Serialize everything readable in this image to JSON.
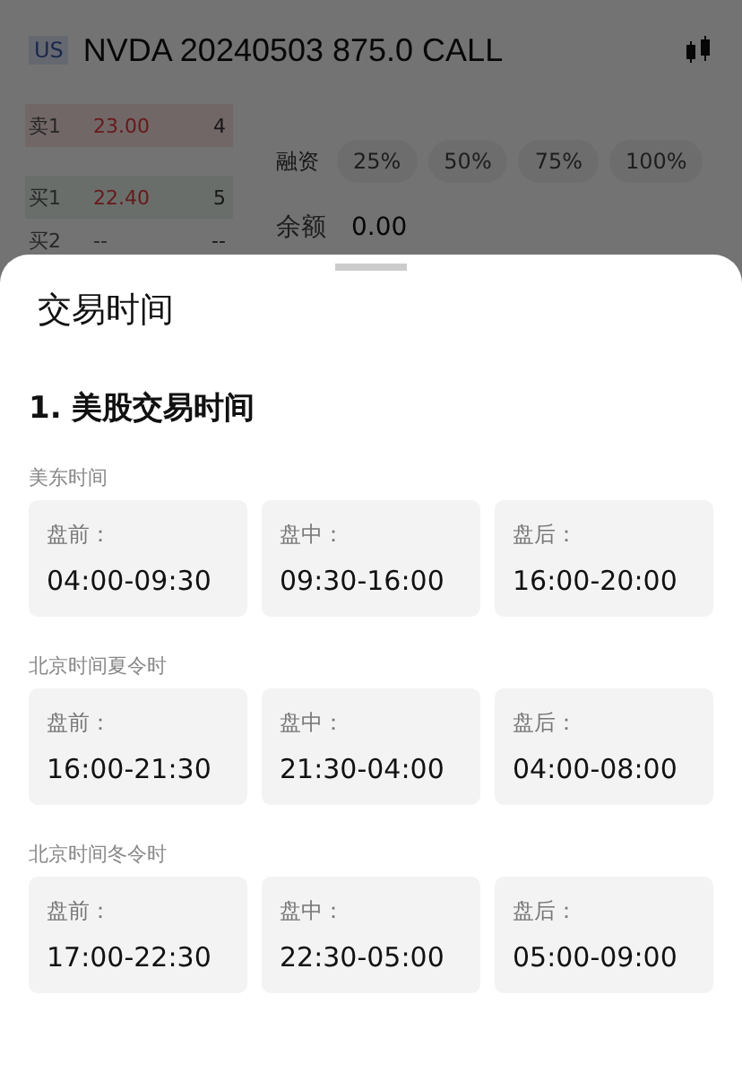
{
  "header": {
    "market": "US",
    "title": "NVDA 20240503 875.0 CALL"
  },
  "order_book": [
    {
      "kind": "sell",
      "label": "卖1",
      "price": "23.00",
      "qty": "4"
    },
    {
      "kind": "buy",
      "label": "买1",
      "price": "22.40",
      "qty": "5"
    },
    {
      "kind": "plain",
      "label": "买2",
      "price": "--",
      "qty": "--"
    }
  ],
  "margin": {
    "label": "融资",
    "options": [
      "25%",
      "50%",
      "75%",
      "100%"
    ]
  },
  "balance": {
    "label": "余额",
    "value": "0.00"
  },
  "sheet": {
    "title": "交易时间",
    "section": "1. 美股交易时间",
    "groups": [
      {
        "label": "美东时间",
        "sessions": [
          {
            "label": "盘前：",
            "time": "04:00-09:30"
          },
          {
            "label": "盘中：",
            "time": "09:30-16:00"
          },
          {
            "label": "盘后：",
            "time": "16:00-20:00"
          }
        ]
      },
      {
        "label": "北京时间夏令时",
        "sessions": [
          {
            "label": "盘前：",
            "time": "16:00-21:30"
          },
          {
            "label": "盘中：",
            "time": "21:30-04:00"
          },
          {
            "label": "盘后：",
            "time": "04:00-08:00"
          }
        ]
      },
      {
        "label": "北京时间冬令时",
        "sessions": [
          {
            "label": "盘前：",
            "time": "17:00-22:30"
          },
          {
            "label": "盘中：",
            "time": "22:30-05:00"
          },
          {
            "label": "盘后：",
            "time": "05:00-09:00"
          }
        ]
      }
    ]
  }
}
